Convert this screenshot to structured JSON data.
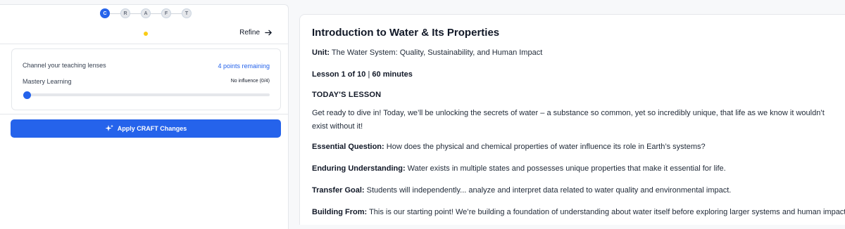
{
  "stepper": {
    "steps": [
      "C",
      "R",
      "A",
      "F",
      "T"
    ]
  },
  "toolbar": {
    "refine_label": "Refine"
  },
  "lenses": {
    "title": "Channel your teaching lenses",
    "points_remaining": "4 points remaining",
    "mastery_label": "Mastery Learning",
    "influence_text": "No influence (0/4)",
    "slider_value": 0,
    "slider_max": 4
  },
  "apply": {
    "label": "Apply CRAFT Changes"
  },
  "colors": {
    "accent": "#2563eb",
    "status_dot": "#facc15"
  },
  "lesson": {
    "title": "Introduction to Water & Its Properties",
    "unit_label": "Unit:",
    "unit_value": "The Water System: Quality, Sustainability, and Human Impact",
    "meta_left": "Lesson 1 of 10",
    "meta_sep": "|",
    "meta_right": "60 minutes",
    "section_heading": "TODAY'S LESSON",
    "intro": "Get ready to dive in! Today, we’ll be unlocking the secrets of water – a substance so common, yet so incredibly unique, that life as we know it wouldn’t exist without it!",
    "eq_label": "Essential Question:",
    "eq_value": "How does the physical and chemical properties of water influence its role in Earth’s systems?",
    "eu_label": "Enduring Understanding:",
    "eu_value": "Water exists in multiple states and possesses unique properties that make it essential for life.",
    "tg_label": "Transfer Goal:",
    "tg_value": "Students will independently... analyze and interpret data related to water quality and environmental impact.",
    "bf_label": "Building From:",
    "bf_value": "This is our starting point! We’re building a foundation of understanding about water itself before exploring larger systems and human impacts."
  }
}
